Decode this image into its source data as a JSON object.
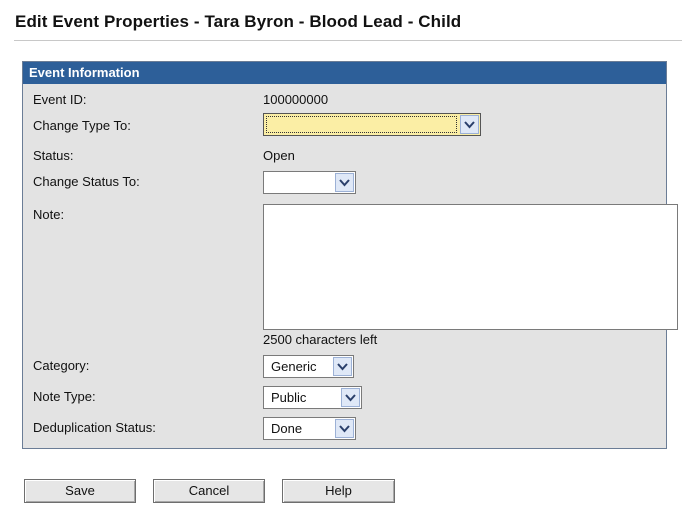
{
  "page": {
    "title": "Edit Event Properties - Tara Byron - Blood Lead - Child"
  },
  "panel": {
    "header": "Event Information"
  },
  "fields": {
    "event_id_label": "Event ID:",
    "event_id_value": "100000000",
    "change_type_label": "Change Type To:",
    "change_type_value": "",
    "status_label": "Status:",
    "status_value": "Open",
    "change_status_label": "Change Status To:",
    "change_status_value": "",
    "note_label": "Note:",
    "note_value": "",
    "chars_left": "2500  characters left",
    "category_label": "Category:",
    "category_value": "Generic",
    "note_type_label": "Note Type:",
    "note_type_value": "Public",
    "dedup_label": "Deduplication Status:",
    "dedup_value": "Done"
  },
  "buttons": {
    "save": "Save",
    "cancel": "Cancel",
    "help": "Help"
  },
  "colors": {
    "header_bg": "#2d5f99",
    "panel_bg": "#e3e3e3",
    "focused_select_bg": "#fbeea5"
  }
}
